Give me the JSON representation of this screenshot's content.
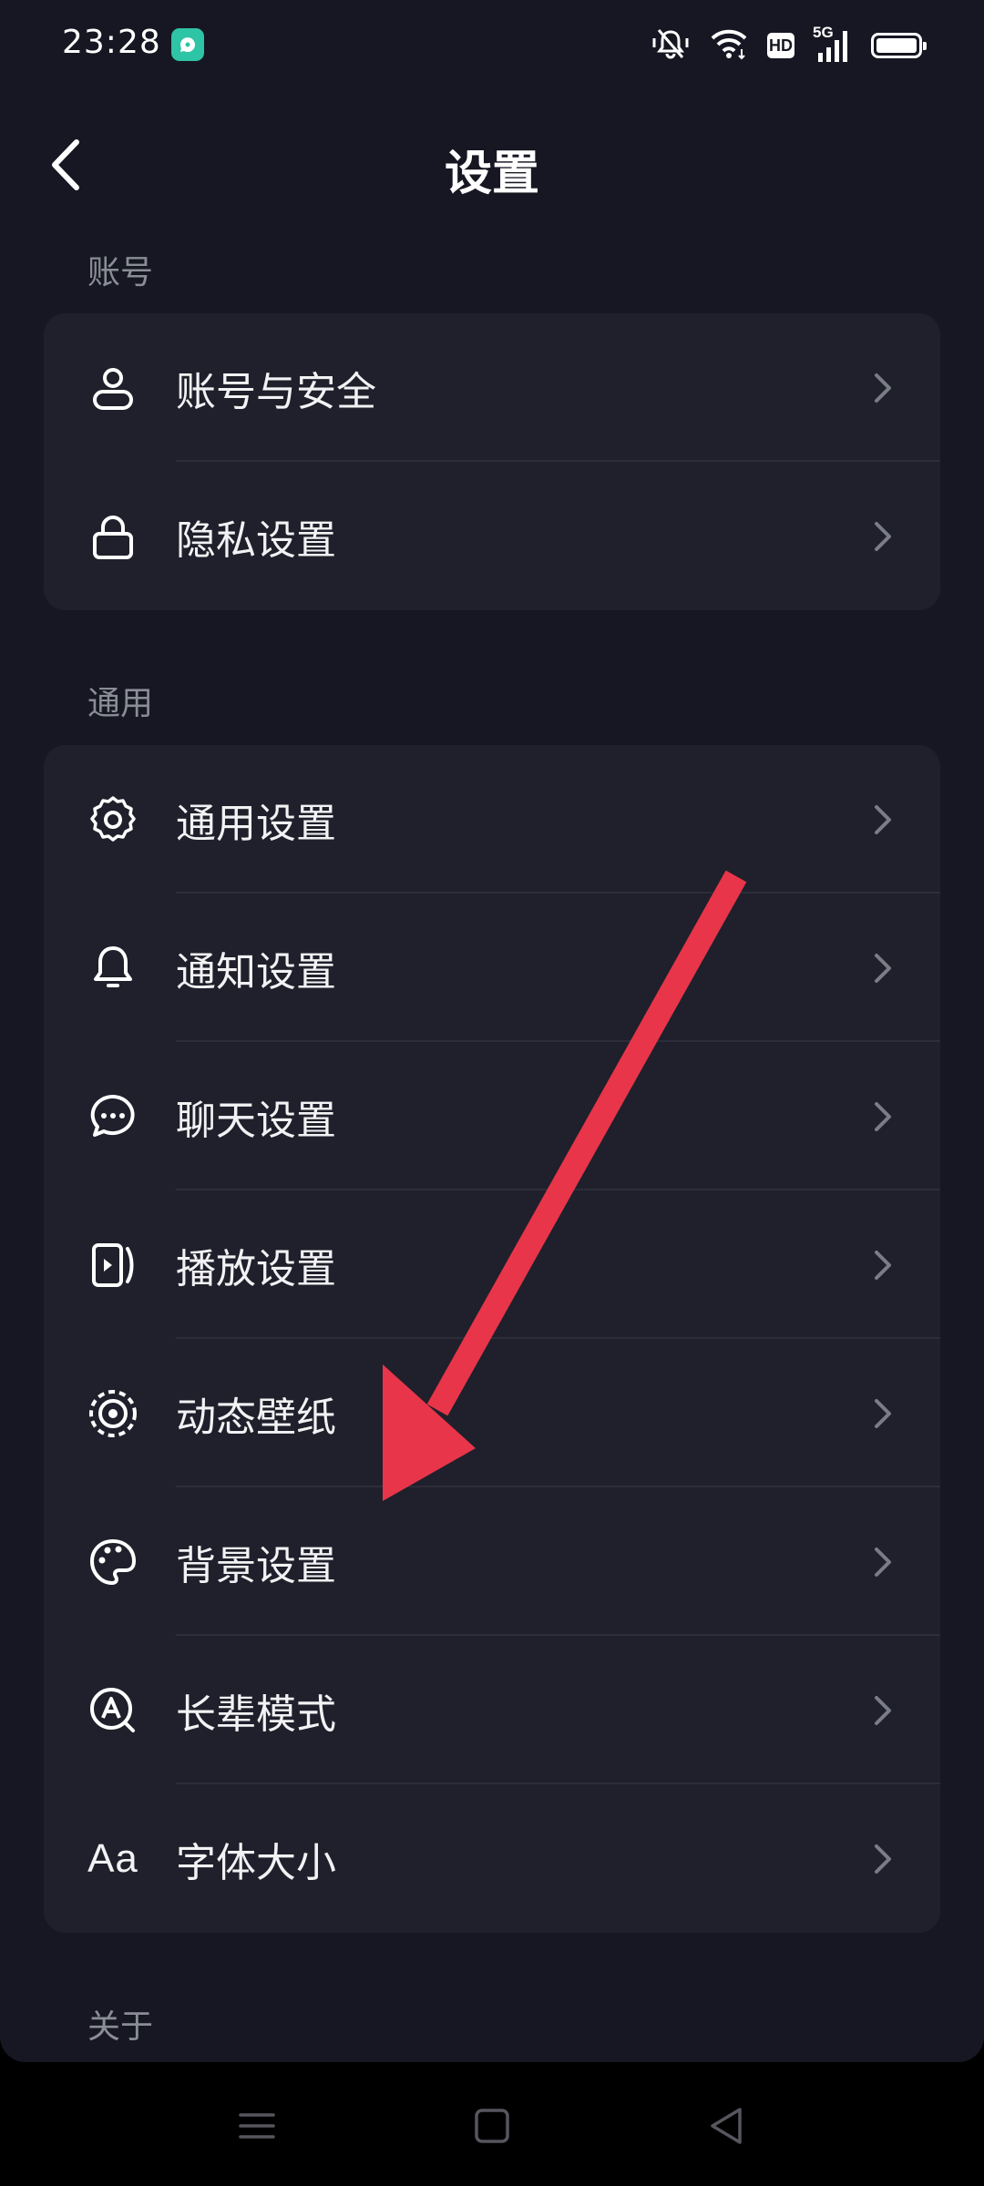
{
  "status_bar": {
    "time": "23:28",
    "network": "5G",
    "hd": "HD",
    "icons": [
      "app-notification-icon",
      "mute-icon",
      "wifi-icon",
      "hd-icon",
      "signal-5g-icon",
      "battery-icon"
    ]
  },
  "header": {
    "title": "设置",
    "back_icon": "chevron-left-icon"
  },
  "sections": {
    "account": {
      "label": "账号",
      "items": [
        {
          "label": "账号与安全",
          "icon": "user-icon"
        },
        {
          "label": "隐私设置",
          "icon": "lock-icon"
        }
      ]
    },
    "general": {
      "label": "通用",
      "items": [
        {
          "label": "通用设置",
          "icon": "gear-icon"
        },
        {
          "label": "通知设置",
          "icon": "bell-icon"
        },
        {
          "label": "聊天设置",
          "icon": "chat-icon"
        },
        {
          "label": "播放设置",
          "icon": "play-icon"
        },
        {
          "label": "动态壁纸",
          "icon": "live-wallpaper-icon"
        },
        {
          "label": "背景设置",
          "icon": "palette-icon"
        },
        {
          "label": "长辈模式",
          "icon": "elder-mode-icon"
        },
        {
          "label": "字体大小",
          "icon": "font-size-icon",
          "icon_text": "Aa"
        }
      ]
    },
    "about": {
      "label": "关于"
    }
  },
  "colors": {
    "background": "#161722",
    "card": "#1f202b",
    "section_label": "#8a8c96",
    "arrow": "#e8354a"
  },
  "nav_bar": [
    "menu-icon",
    "home-square-icon",
    "back-triangle-icon"
  ]
}
